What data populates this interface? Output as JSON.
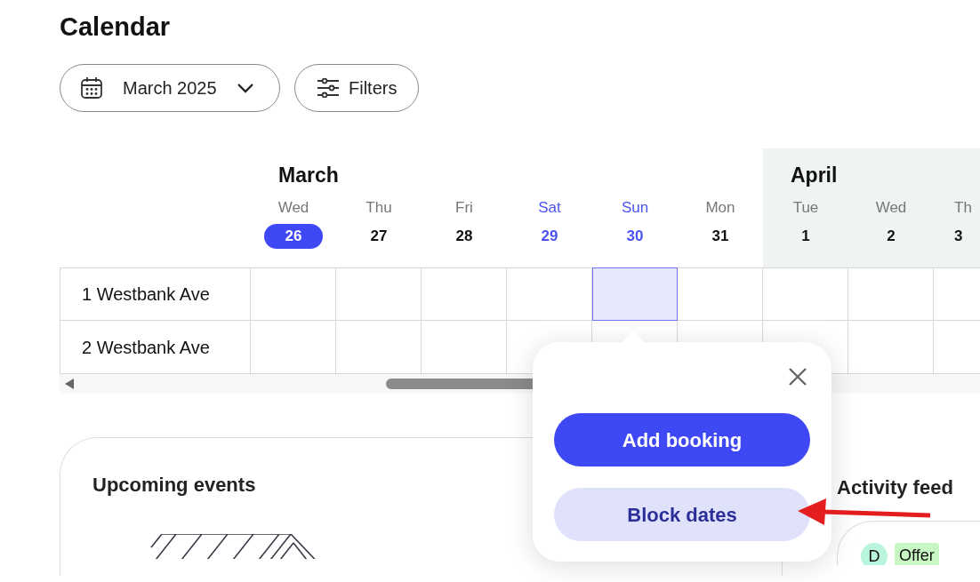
{
  "page": {
    "title": "Calendar"
  },
  "toolbar": {
    "month_picker": {
      "value": "March 2025"
    },
    "filters": {
      "label": "Filters"
    }
  },
  "calendar": {
    "months": [
      {
        "name": "March",
        "shaded": false,
        "days": [
          {
            "weekday": "Wed",
            "date": "26",
            "today": true,
            "weekend": false
          },
          {
            "weekday": "Thu",
            "date": "27",
            "today": false,
            "weekend": false
          },
          {
            "weekday": "Fri",
            "date": "28",
            "today": false,
            "weekend": false
          },
          {
            "weekday": "Sat",
            "date": "29",
            "today": false,
            "weekend": true
          },
          {
            "weekday": "Sun",
            "date": "30",
            "today": false,
            "weekend": true
          },
          {
            "weekday": "Mon",
            "date": "31",
            "today": false,
            "weekend": false
          }
        ]
      },
      {
        "name": "April",
        "shaded": true,
        "days": [
          {
            "weekday": "Tue",
            "date": "1",
            "today": false,
            "weekend": false
          },
          {
            "weekday": "Wed",
            "date": "2",
            "today": false,
            "weekend": false
          },
          {
            "weekday": "Th",
            "date": "3",
            "today": false,
            "weekend": false
          }
        ]
      }
    ],
    "rows": [
      {
        "label": "1 Westbank Ave",
        "cells": [
          {
            "selected": false
          },
          {
            "selected": false
          },
          {
            "selected": false
          },
          {
            "selected": false
          },
          {
            "selected": true
          },
          {
            "selected": false
          },
          {
            "selected": false
          },
          {
            "selected": false
          },
          {
            "selected": false
          }
        ]
      },
      {
        "label": "2 Westbank Ave",
        "cells": [
          {
            "selected": false
          },
          {
            "selected": false
          },
          {
            "selected": false
          },
          {
            "selected": false
          },
          {
            "selected": false
          },
          {
            "selected": false
          },
          {
            "selected": false
          },
          {
            "selected": false
          },
          {
            "selected": false
          }
        ]
      }
    ]
  },
  "popover": {
    "actions": [
      {
        "label": "Add booking",
        "kind": "primary"
      },
      {
        "label": "Block dates",
        "kind": "secondary"
      }
    ]
  },
  "upcoming_events": {
    "title": "Upcoming events"
  },
  "activity_feed": {
    "title": "Activity feed",
    "items": [
      {
        "avatar": "D",
        "tag": "Offer"
      }
    ]
  }
}
